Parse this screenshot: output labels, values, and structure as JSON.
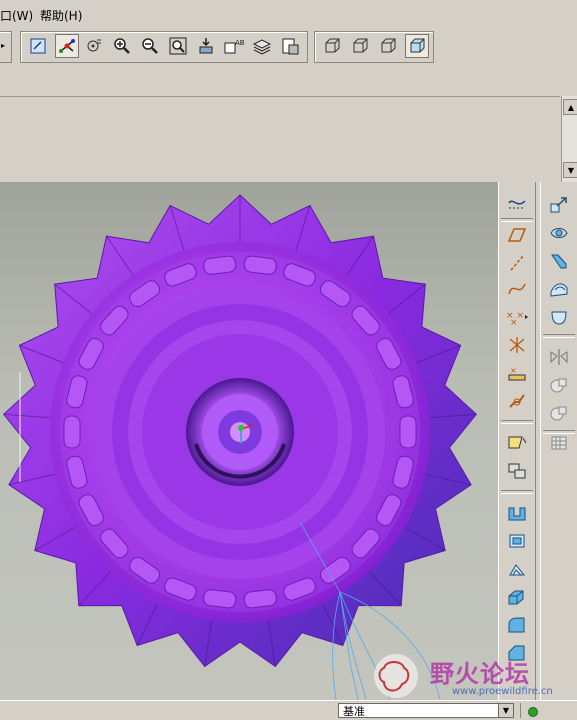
{
  "menubar": {
    "items": [
      {
        "label": "口(W)"
      },
      {
        "label": "帮助(H)"
      }
    ]
  },
  "toolbar": {
    "view_buttons": [
      "repaint-icon",
      "spin-center-icon",
      "orient-mode-icon",
      "zoom-in-icon",
      "zoom-out-icon",
      "refit-icon",
      "reorient-icon",
      "saved-views-icon",
      "layers-icon",
      "model-setup-icon"
    ],
    "display_buttons": [
      "wireframe-icon",
      "hidden-line-icon",
      "no-hidden-icon",
      "shading-icon"
    ]
  },
  "status": {
    "filter_value": "基准"
  },
  "watermark": {
    "text": "野火论坛",
    "url": "www.proewildfire.cn"
  },
  "colors": {
    "model_main": "#a030e8",
    "model_dark": "#5a1aa8",
    "model_shadow": "#3a2a98",
    "background": "#b4b8af"
  }
}
